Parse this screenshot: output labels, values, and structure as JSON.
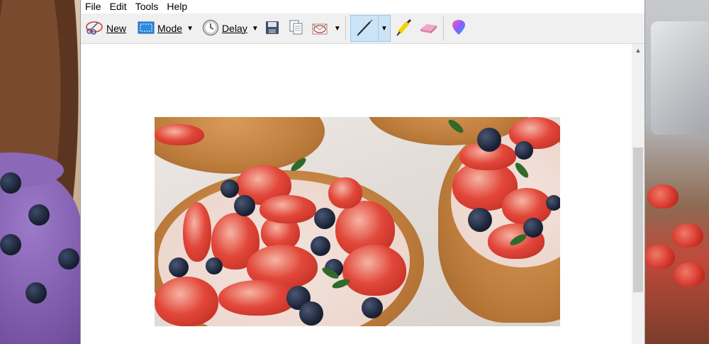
{
  "app": {
    "menu": [
      "File",
      "Edit",
      "Tools",
      "Help"
    ]
  },
  "toolbar": {
    "new_label": "New",
    "mode_label": "Mode",
    "delay_label": "Delay",
    "icons": [
      "new-snip-icon",
      "mode-icon",
      "delay-clock-icon",
      "save-icon",
      "copy-icon",
      "send-email-icon",
      "pen-icon",
      "highlighter-icon",
      "eraser-icon",
      "paint3d-icon"
    ],
    "active_tool": "pen"
  },
  "colors": {
    "toolbar_bg": "#f0f0f0",
    "pen_active_bg": "#cce4f7",
    "accent": "#99c9ef"
  }
}
